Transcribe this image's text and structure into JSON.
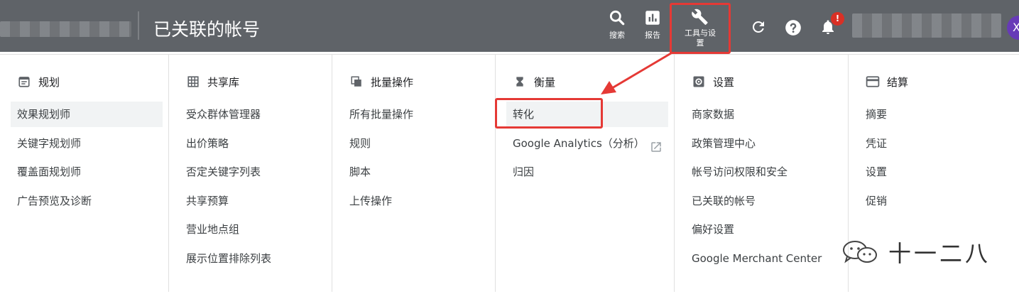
{
  "header": {
    "page_title": "已关联的帐号",
    "search_label": "搜索",
    "report_label": "报告",
    "tools_label_line1": "工具与设",
    "tools_label_line2": "置",
    "notification_badge": "!",
    "avatar_letter": "X",
    "accent_red": "#e53935",
    "bar_color": "#5f6368"
  },
  "menu": {
    "columns": [
      {
        "icon": "calendar-icon",
        "title": "规划",
        "items": [
          "效果规划师",
          "关键字规划师",
          "覆盖面规划师",
          "广告预览及诊断"
        ],
        "selected": 0
      },
      {
        "icon": "grid-icon",
        "title": "共享库",
        "items": [
          "受众群体管理器",
          "出价策略",
          "否定关键字列表",
          "共享预算",
          "营业地点组",
          "展示位置排除列表"
        ]
      },
      {
        "icon": "copy-icon",
        "title": "批量操作",
        "items": [
          "所有批量操作",
          "规则",
          "脚本",
          "上传操作"
        ]
      },
      {
        "icon": "hourglass-icon",
        "title": "衡量",
        "items": [
          "转化",
          "Google Analytics（分析）",
          "归因"
        ],
        "selected": 0
      },
      {
        "icon": "gear-square-icon",
        "title": "设置",
        "items": [
          "商家数据",
          "政策管理中心",
          "帐号访问权限和安全",
          "已关联的帐号",
          "偏好设置",
          "Google Merchant Center"
        ]
      },
      {
        "icon": "card-icon",
        "title": "结算",
        "items": [
          "摘要",
          "凭证",
          "设置",
          "促销"
        ]
      }
    ]
  },
  "watermark": {
    "text": "十一二八",
    "icon": "wechat-icon"
  }
}
